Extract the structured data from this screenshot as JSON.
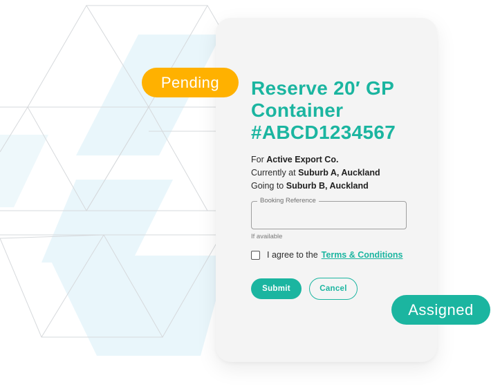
{
  "colors": {
    "accent": "#1bb5a0",
    "pending": "#ffb100",
    "card": "#f4f4f4",
    "background_pattern": "#e9f6fb"
  },
  "badges": {
    "pending": "Pending",
    "assigned": "Assigned"
  },
  "card": {
    "title_lines": [
      "Reserve 20′ GP",
      "Container",
      "#ABCD1234567"
    ],
    "meta": {
      "for_prefix": "For",
      "for_value": "Active Export Co.",
      "current_prefix": "Currently at",
      "current_value": "Suburb A, Auckland",
      "going_prefix": "Going to",
      "going_value": "Suburb B, Auckland"
    },
    "booking_field": {
      "label": "Booking Reference",
      "value": "",
      "helper": "If available"
    },
    "agree": {
      "text": "I agree to the",
      "link": "Terms & Conditions",
      "checked": false
    },
    "buttons": {
      "submit": "Submit",
      "cancel": "Cancel"
    }
  }
}
